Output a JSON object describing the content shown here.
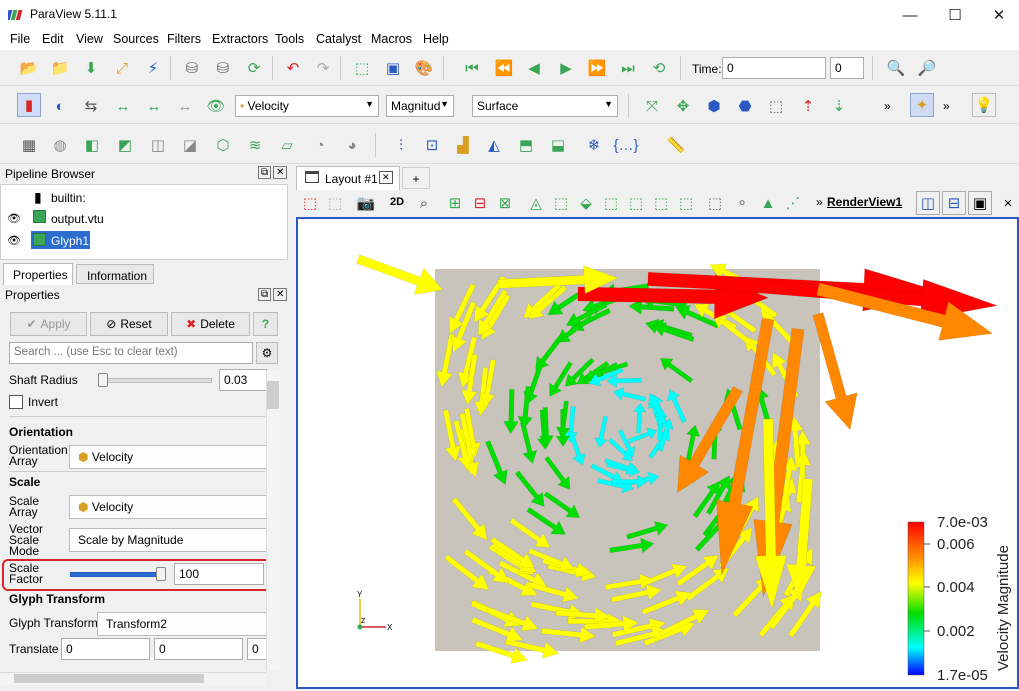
{
  "window": {
    "title": "ParaView 5.11.1"
  },
  "menu": [
    "File",
    "Edit",
    "View",
    "Sources",
    "Filters",
    "Extractors",
    "Tools",
    "Catalyst",
    "Macros",
    "Help"
  ],
  "toolbar": {
    "time_label": "Time:",
    "time_value": "0",
    "time_step": "0",
    "color_array": "Velocity",
    "component": "Magnitud",
    "representation": "Surface",
    "more": "»"
  },
  "pipeline": {
    "title": "Pipeline Browser",
    "items": [
      "builtin:",
      "output.vtu",
      "Glyph1"
    ]
  },
  "tabs": {
    "properties": "Properties",
    "information": "Information"
  },
  "properties": {
    "title": "Properties",
    "apply": "Apply",
    "reset": "Reset",
    "delete": "Delete",
    "help": "?",
    "search_placeholder": "Search ... (use Esc to clear text)",
    "shaft_radius_label": "Shaft Radius",
    "shaft_radius_value": "0.03",
    "invert_label": "Invert",
    "orientation_section": "Orientation",
    "orientation_array_label": "Orientation Array",
    "orientation_array_value": "Velocity",
    "scale_section": "Scale",
    "scale_array_label": "Scale Array",
    "scale_array_value": "Velocity",
    "vector_scale_mode_label": "Vector Scale Mode",
    "vector_scale_mode_value": "Scale by Magnitude",
    "scale_factor_label": "Scale Factor",
    "scale_factor_value": "100",
    "glyph_transform_section": "Glyph Transform",
    "glyph_transform_label": "Glyph Transform",
    "glyph_transform_value": "Transform2",
    "translate_label": "Translate",
    "translate_values": [
      "0",
      "0",
      "0"
    ]
  },
  "layout": {
    "tab_label": "Layout #1",
    "add_tab": "+",
    "mode_2d": "2D",
    "render_view_label": "RenderView1",
    "more": "»"
  },
  "colorbar": {
    "title": "Velocity Magnitude",
    "ticks": [
      "7.0e-03",
      "0.006",
      "0.004",
      "0.002",
      "1.7e-05"
    ],
    "colors": [
      "#ff0000",
      "#ff8800",
      "#ffff00",
      "#00dd00",
      "#00ffff",
      "#0000ff"
    ]
  },
  "axes": {
    "x": "X",
    "y": "Y",
    "z": "Z"
  },
  "colors": {
    "accent": "#2b59c3",
    "highlight_border": "#d9262a"
  }
}
